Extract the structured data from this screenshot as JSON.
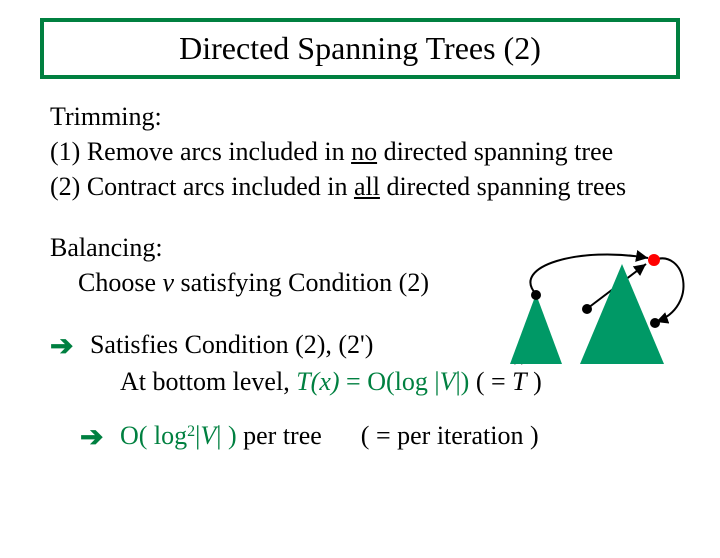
{
  "title": "Directed Spanning Trees (2)",
  "trimming": {
    "heading": "Trimming:",
    "line1_a": "(1) Remove arcs included in ",
    "line1_u": "no",
    "line1_b": " directed spanning tree",
    "line2_a": "(2) Contract arcs included in ",
    "line2_u": "all",
    "line2_b": " directed spanning trees"
  },
  "balancing": {
    "heading": "Balancing:",
    "line_a": "Choose ",
    "line_v": "v",
    "line_b": " satisfying Condition (2)"
  },
  "result": {
    "arrow": "➔",
    "sat": "Satisfies  Condition (2), (2')",
    "bottom_a": "At bottom level, ",
    "bottom_tx": "T(x)",
    "bottom_eq": " = O(log |",
    "bottom_v": "V",
    "bottom_close": "|)",
    "paren_open": "  ( = ",
    "paren_t": "T",
    "paren_close": " )"
  },
  "complexity": {
    "arrow": "➔",
    "a": "O( log",
    "exp": "2",
    "b": "|",
    "v": "V",
    "c": "| )",
    "per_tree": "  per tree",
    "per_iter": "( = per iteration )"
  }
}
